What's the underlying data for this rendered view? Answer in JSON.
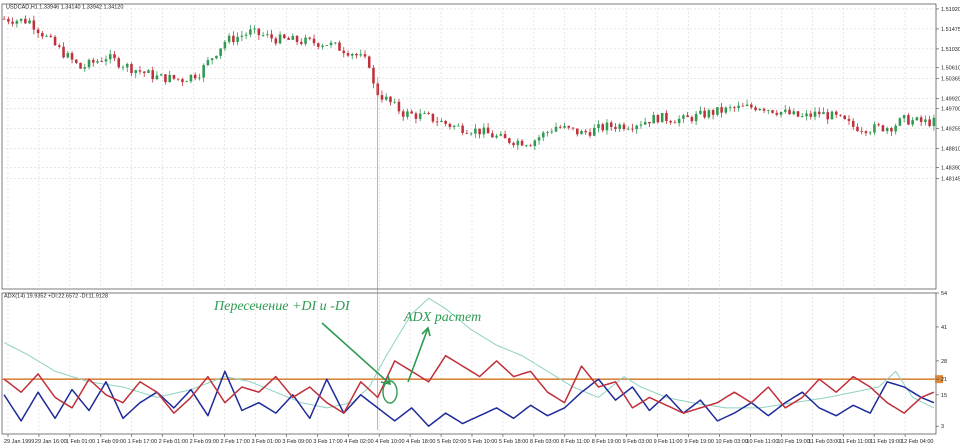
{
  "symbol_header": "USDCAD,H1  1.33946  1.34140  1.33942  1.34120",
  "indicator_header": "ADX(14) 19.9352  +DI:22.6572  -DI:11.9128",
  "annotations": {
    "cross": "Пересечение +DI и -DI",
    "adx": "ADX растет"
  },
  "colors": {
    "bull": "#2e9a52",
    "bear": "#c0303a",
    "adx": "#8fd1c2",
    "plus_di": "#1f2a9a",
    "minus_di": "#c0303a",
    "level": "#d9873e",
    "grid": "#cfcfcf",
    "vline": "#8b8b60"
  },
  "chart_data": [
    {
      "type": "candlestick",
      "title": "USDCAD,H1",
      "ylim": [
        1.4568,
        1.5203
      ],
      "y_ticks": [
        "1.51920",
        "1.51475",
        "1.51030",
        "1.50610",
        "1.50365",
        "1.49920",
        "1.49700",
        "1.49255",
        "1.48810",
        "1.48390",
        "1.48145"
      ],
      "x_ticks": [
        "29 Jan 1999",
        "29 Jan 16:00",
        "1 Feb 01:00",
        "1 Feb 09:00",
        "1 Feb 17:00",
        "2 Feb 01:00",
        "2 Feb 09:00",
        "2 Feb 17:00",
        "3 Feb 01:00",
        "3 Feb 09:00",
        "3 Feb 17:00",
        "4 Feb 02:00",
        "4 Feb 10:00",
        "4 Feb 18:00",
        "5 Feb 02:00",
        "5 Feb 10:00",
        "5 Feb 18:00",
        "8 Feb 03:00",
        "8 Feb 11:00",
        "8 Feb 19:00",
        "9 Feb 03:00",
        "9 Feb 11:00",
        "9 Feb 19:00",
        "10 Feb 03:00",
        "10 Feb 11:00",
        "10 Feb 19:00",
        "11 Feb 03:00",
        "11 Feb 11:00",
        "11 Feb 19:00",
        "12 Feb 04:00"
      ],
      "close_path": [
        [
          0,
          1.517
        ],
        [
          6,
          1.5165
        ],
        [
          12,
          1.511
        ],
        [
          18,
          1.506
        ],
        [
          24,
          1.5085
        ],
        [
          30,
          1.506
        ],
        [
          36,
          1.504
        ],
        [
          42,
          1.5035
        ],
        [
          46,
          1.505
        ],
        [
          52,
          1.512
        ],
        [
          58,
          1.514
        ],
        [
          64,
          1.5125
        ],
        [
          70,
          1.512
        ],
        [
          76,
          1.5115
        ],
        [
          82,
          1.5095
        ],
        [
          86,
          1.507
        ],
        [
          88,
          1.5005
        ],
        [
          90,
          1.499
        ],
        [
          94,
          1.496
        ],
        [
          100,
          1.495
        ],
        [
          106,
          1.493
        ],
        [
          112,
          1.492
        ],
        [
          118,
          1.49
        ],
        [
          124,
          1.4895
        ],
        [
          130,
          1.493
        ],
        [
          136,
          1.4915
        ],
        [
          142,
          1.493
        ],
        [
          148,
          1.4935
        ],
        [
          154,
          1.495
        ],
        [
          160,
          1.4945
        ],
        [
          166,
          1.496
        ],
        [
          172,
          1.497
        ],
        [
          178,
          1.4975
        ],
        [
          184,
          1.496
        ],
        [
          188,
          1.495
        ],
        [
          192,
          1.496
        ],
        [
          196,
          1.495
        ],
        [
          200,
          1.493
        ],
        [
          204,
          1.4925
        ],
        [
          209,
          1.493
        ],
        [
          212,
          1.4945
        ],
        [
          216,
          1.494
        ],
        [
          219,
          1.494
        ]
      ],
      "n_candles": 220,
      "highlight_line_index": 88
    },
    {
      "type": "line",
      "title": "ADX(14)",
      "ylim": [
        0,
        54
      ],
      "y_ticks": [
        "54",
        "41",
        "28",
        "21",
        "15",
        "3"
      ],
      "level": 21,
      "level_label": "21",
      "series": [
        {
          "name": "ADX",
          "path": [
            [
              0,
              35
            ],
            [
              6,
              30
            ],
            [
              12,
              24
            ],
            [
              20,
              20
            ],
            [
              28,
              18
            ],
            [
              36,
              14
            ],
            [
              44,
              17
            ],
            [
              52,
              22
            ],
            [
              58,
              20
            ],
            [
              64,
              16
            ],
            [
              70,
              12
            ],
            [
              76,
              10
            ],
            [
              82,
              12
            ],
            [
              86,
              18
            ],
            [
              90,
              30
            ],
            [
              96,
              46
            ],
            [
              100,
              52
            ],
            [
              104,
              48
            ],
            [
              110,
              40
            ],
            [
              116,
              34
            ],
            [
              122,
              30
            ],
            [
              128,
              24
            ],
            [
              134,
              18
            ],
            [
              140,
              14
            ],
            [
              146,
              22
            ],
            [
              150,
              18
            ],
            [
              156,
              14
            ],
            [
              162,
              12
            ],
            [
              170,
              10
            ],
            [
              178,
              10
            ],
            [
              186,
              12
            ],
            [
              194,
              14
            ],
            [
              200,
              16
            ],
            [
              206,
              18
            ],
            [
              210,
              24
            ],
            [
              214,
              14
            ],
            [
              219,
              10
            ]
          ]
        },
        {
          "name": "+DI",
          "path": [
            [
              0,
              15
            ],
            [
              4,
              5
            ],
            [
              8,
              16
            ],
            [
              12,
              6
            ],
            [
              16,
              17
            ],
            [
              20,
              9
            ],
            [
              24,
              20
            ],
            [
              28,
              6
            ],
            [
              32,
              12
            ],
            [
              36,
              16
            ],
            [
              40,
              10
            ],
            [
              44,
              17
            ],
            [
              48,
              7
            ],
            [
              52,
              24
            ],
            [
              56,
              9
            ],
            [
              60,
              12
            ],
            [
              64,
              8
            ],
            [
              68,
              15
            ],
            [
              72,
              6
            ],
            [
              76,
              21
            ],
            [
              80,
              8
            ],
            [
              84,
              15
            ],
            [
              88,
              10
            ],
            [
              92,
              5
            ],
            [
              96,
              10
            ],
            [
              100,
              3
            ],
            [
              104,
              8
            ],
            [
              108,
              4
            ],
            [
              112,
              7
            ],
            [
              116,
              10
            ],
            [
              120,
              6
            ],
            [
              124,
              11
            ],
            [
              128,
              7
            ],
            [
              132,
              10
            ],
            [
              136,
              16
            ],
            [
              140,
              21
            ],
            [
              144,
              13
            ],
            [
              148,
              18
            ],
            [
              152,
              9
            ],
            [
              156,
              15
            ],
            [
              160,
              8
            ],
            [
              164,
              13
            ],
            [
              168,
              5
            ],
            [
              172,
              8
            ],
            [
              176,
              12
            ],
            [
              180,
              7
            ],
            [
              184,
              12
            ],
            [
              188,
              16
            ],
            [
              192,
              10
            ],
            [
              196,
              7
            ],
            [
              200,
              11
            ],
            [
              204,
              8
            ],
            [
              208,
              20
            ],
            [
              212,
              18
            ],
            [
              216,
              14
            ],
            [
              219,
              12
            ]
          ]
        },
        {
          "name": "-DI",
          "path": [
            [
              0,
              21
            ],
            [
              4,
              16
            ],
            [
              8,
              23
            ],
            [
              12,
              14
            ],
            [
              16,
              10
            ],
            [
              20,
              21
            ],
            [
              24,
              15
            ],
            [
              28,
              12
            ],
            [
              32,
              20
            ],
            [
              36,
              16
            ],
            [
              40,
              8
            ],
            [
              44,
              14
            ],
            [
              48,
              22
            ],
            [
              52,
              12
            ],
            [
              56,
              18
            ],
            [
              60,
              16
            ],
            [
              64,
              22
            ],
            [
              68,
              14
            ],
            [
              72,
              18
            ],
            [
              76,
              12
            ],
            [
              80,
              8
            ],
            [
              84,
              20
            ],
            [
              88,
              14
            ],
            [
              92,
              28
            ],
            [
              96,
              24
            ],
            [
              100,
              20
            ],
            [
              104,
              30
            ],
            [
              108,
              26
            ],
            [
              112,
              22
            ],
            [
              116,
              28
            ],
            [
              120,
              22
            ],
            [
              124,
              24
            ],
            [
              128,
              16
            ],
            [
              132,
              12
            ],
            [
              136,
              26
            ],
            [
              140,
              18
            ],
            [
              144,
              20
            ],
            [
              148,
              10
            ],
            [
              152,
              14
            ],
            [
              156,
              11
            ],
            [
              160,
              8
            ],
            [
              164,
              10
            ],
            [
              168,
              12
            ],
            [
              172,
              16
            ],
            [
              176,
              12
            ],
            [
              180,
              18
            ],
            [
              184,
              10
            ],
            [
              188,
              14
            ],
            [
              192,
              21
            ],
            [
              196,
              16
            ],
            [
              200,
              22
            ],
            [
              204,
              18
            ],
            [
              208,
              12
            ],
            [
              212,
              8
            ],
            [
              216,
              14
            ],
            [
              219,
              16
            ]
          ]
        }
      ]
    }
  ]
}
